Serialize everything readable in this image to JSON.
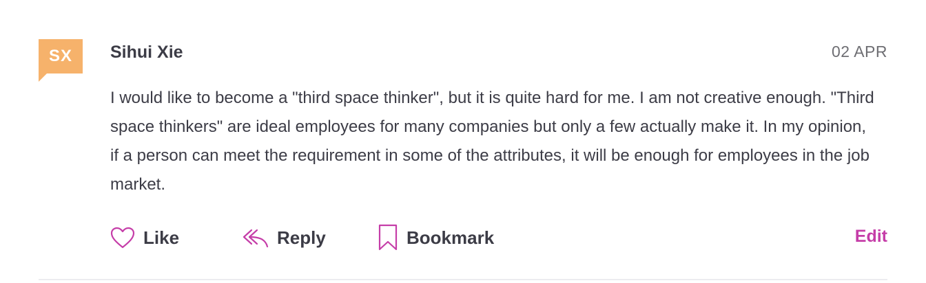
{
  "comment": {
    "avatar_initials": "SX",
    "avatar_color": "#f6b26b",
    "author": "Sihui Xie",
    "date": "02 APR",
    "text": "I would like to become a \"third space thinker\", but it is quite hard for me. I am not creative enough. \"Third space thinkers\" are ideal employees for many companies but only a few actually make it. In my opinion, if a person can meet the requirement in some of the attributes, it will be enough for employees in the job market."
  },
  "actions": {
    "like_label": "Like",
    "like_icon": "heart-outline-icon",
    "reply_label": "Reply",
    "reply_icon": "reply-arrow-icon",
    "bookmark_label": "Bookmark",
    "bookmark_icon": "bookmark-outline-icon",
    "edit_label": "Edit"
  },
  "colors": {
    "accent": "#c53da8",
    "text": "#3c3c46",
    "muted": "#6e6e73"
  }
}
